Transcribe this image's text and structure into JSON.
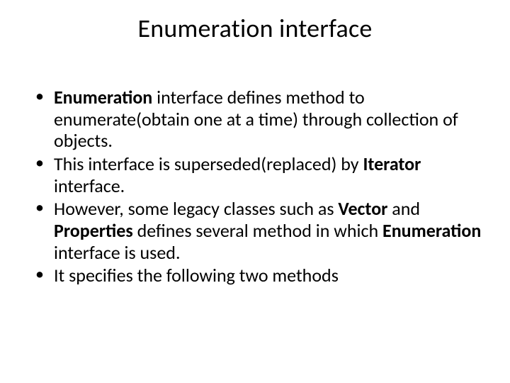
{
  "slide": {
    "title": "Enumeration interface",
    "bullets": [
      {
        "pre": "",
        "bold1": "Enumeration",
        "mid1": " interface defines method to enumerate(obtain one at a time) through collection of objects.",
        "bold2": "",
        "mid2": "",
        "bold3": "",
        "tail": ""
      },
      {
        "pre": "This interface is superseded(replaced) by ",
        "bold1": "Iterator",
        "mid1": " interface.",
        "bold2": "",
        "mid2": "",
        "bold3": "",
        "tail": ""
      },
      {
        "pre": "However, some legacy classes such as ",
        "bold1": "Vector",
        "mid1": " and ",
        "bold2": "Properties",
        "mid2": " defines several method in which ",
        "bold3": "Enumeration",
        "tail": " interface is used."
      },
      {
        "pre": "It specifies the following two methods",
        "bold1": "",
        "mid1": "",
        "bold2": "",
        "mid2": "",
        "bold3": "",
        "tail": ""
      }
    ]
  }
}
